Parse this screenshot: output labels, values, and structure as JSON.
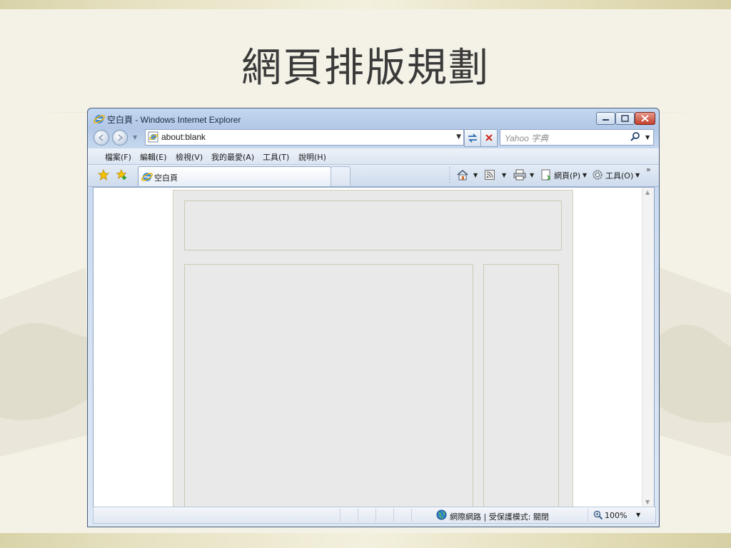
{
  "slide": {
    "title": "網頁排版規劃"
  },
  "window": {
    "title": "空白頁 - Windows Internet Explorer",
    "address": "about:blank",
    "search_placeholder": "Yahoo 字典",
    "menu": [
      "檔案(F)",
      "編輯(E)",
      "檢視(V)",
      "我的最愛(A)",
      "工具(T)",
      "說明(H)"
    ],
    "tab_label": "空白頁",
    "toolbar": {
      "page_label": "網頁(P)",
      "tools_label": "工具(O)"
    },
    "status": {
      "zone": "網際網路 | 受保護模式: 關閉",
      "zoom": "100%"
    }
  },
  "colors": {
    "accent": "#c3d7f0",
    "mock_block": "#e9e9e9",
    "slide_bg": "#f4f2e6"
  }
}
